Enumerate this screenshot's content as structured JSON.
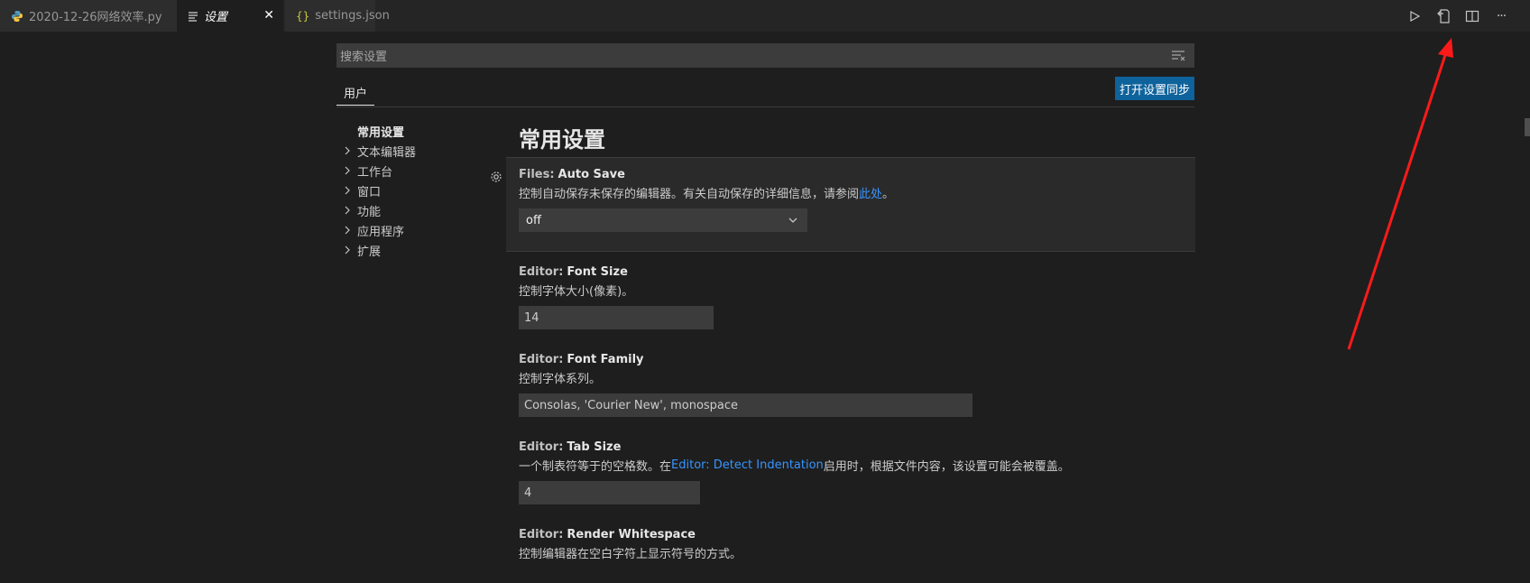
{
  "tabs": [
    {
      "label": "2020-12-26网络效率.py",
      "icon": "python-icon"
    },
    {
      "label": "设置",
      "icon": "settings-list-icon",
      "active": true
    },
    {
      "label": "settings.json",
      "icon": "json-braces-icon"
    }
  ],
  "tab_close_symbol": "✕",
  "editor_actions": [
    "run-icon",
    "open-settings-json-icon",
    "split-editor-icon",
    "more-actions-icon"
  ],
  "more_symbol": "···",
  "search": {
    "placeholder": "搜索设置"
  },
  "scope_tab": "用户",
  "sync_button": "打开设置同步",
  "toc": {
    "active": "常用设置",
    "items": [
      "文本编辑器",
      "工作台",
      "窗口",
      "功能",
      "应用程序",
      "扩展"
    ]
  },
  "group_title": "常用设置",
  "settings": {
    "autosave": {
      "category": "Files:",
      "key": "Auto Save",
      "desc_before": "控制自动保存未保存的编辑器。有关自动保存的详细信息，请参阅",
      "desc_link": "此处",
      "desc_after": "。",
      "value": "off"
    },
    "fontsize": {
      "category": "Editor:",
      "key": "Font Size",
      "desc": "控制字体大小(像素)。",
      "value": "14"
    },
    "fontfamily": {
      "category": "Editor:",
      "key": "Font Family",
      "desc": "控制字体系列。",
      "value": "Consolas, 'Courier New', monospace"
    },
    "tabsize": {
      "category": "Editor:",
      "key": "Tab Size",
      "desc_before": "一个制表符等于的空格数。在 ",
      "desc_link": "Editor: Detect Indentation",
      "desc_after": " 启用时，根据文件内容，该设置可能会被覆盖。",
      "value": "4"
    },
    "renderws": {
      "category": "Editor:",
      "key": "Render Whitespace",
      "desc": "控制编辑器在空白字符上显示符号的方式。"
    }
  },
  "colors": {
    "accent": "#0e639c",
    "link": "#3794ff",
    "annotation_arrow": "#ff1a1a"
  }
}
